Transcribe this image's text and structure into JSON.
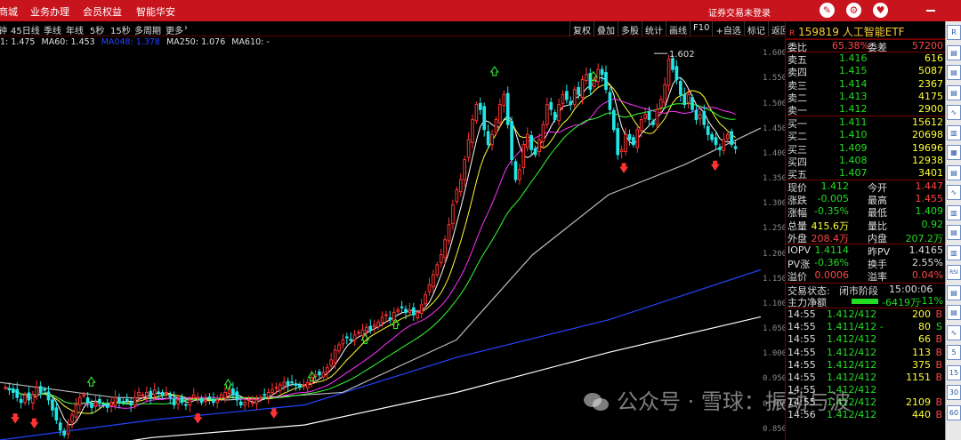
{
  "topbar": {
    "menu": [
      "商城",
      "业务办理",
      "会员权益",
      "智能华安"
    ],
    "login_text": "证券交易未登录",
    "icons": [
      "wrench-icon",
      "gear-icon",
      "shirt-icon",
      "minimize-icon"
    ]
  },
  "periodbar": {
    "items": [
      "钟",
      "45日线",
      "季线",
      "年线",
      "5秒",
      "15秒",
      "多周期",
      "更多",
      "›"
    ],
    "tools": [
      "复权",
      "叠加",
      "多股",
      "统计",
      "画线",
      "F10",
      "+自选",
      "标记",
      "返回"
    ]
  },
  "ma_legend": [
    {
      "text": "1: 1.475",
      "color": "#e0e0e0"
    },
    {
      "text": "MA60: 1.453",
      "color": "#e0e0e0"
    },
    {
      "text": "MA048: 1.378",
      "color": "#2244ff"
    },
    {
      "text": "MA250: 1.076",
      "color": "#e0e0e0"
    },
    {
      "text": "MA610: -",
      "color": "#e0e0e0"
    }
  ],
  "chart_data": {
    "type": "candlestick",
    "ylim": [
      0.83,
      1.62
    ],
    "yticks": [
      "1.600",
      "1.550",
      "1.500",
      "1.450",
      "1.400",
      "1.350",
      "1.300",
      "1.250",
      "1.200",
      "1.150",
      "1.100",
      "1.050",
      "1.000",
      "0.950",
      "0.900",
      "0.850"
    ],
    "high_label": "1.602",
    "closes": [
      0.935,
      0.93,
      0.925,
      0.915,
      0.905,
      0.92,
      0.91,
      0.92,
      0.935,
      0.925,
      0.93,
      0.91,
      0.89,
      0.87,
      0.85,
      0.84,
      0.86,
      0.88,
      0.9,
      0.915,
      0.92,
      0.905,
      0.895,
      0.905,
      0.905,
      0.9,
      0.895,
      0.905,
      0.915,
      0.905,
      0.905,
      0.91,
      0.9,
      0.915,
      0.925,
      0.92,
      0.925,
      0.915,
      0.93,
      0.925,
      0.92,
      0.925,
      0.915,
      0.9,
      0.91,
      0.905,
      0.9,
      0.91,
      0.92,
      0.915,
      0.905,
      0.91,
      0.915,
      0.905,
      0.91,
      0.92,
      0.925,
      0.93,
      0.92,
      0.91,
      0.9,
      0.905,
      0.91,
      0.905,
      0.91,
      0.915,
      0.92,
      0.925,
      0.93,
      0.935,
      0.94,
      0.945,
      0.94,
      0.945,
      0.94,
      0.935,
      0.94,
      0.945,
      0.955,
      0.96,
      0.96,
      0.965,
      0.975,
      0.99,
      1.01,
      1.02,
      1.03,
      1.035,
      1.03,
      1.04,
      1.045,
      1.05,
      1.055,
      1.05,
      1.06,
      1.065,
      1.075,
      1.08,
      1.07,
      1.085,
      1.09,
      1.095,
      1.085,
      1.09,
      1.08,
      1.085,
      1.1,
      1.12,
      1.14,
      1.16,
      1.18,
      1.2,
      1.23,
      1.26,
      1.3,
      1.33,
      1.35,
      1.39,
      1.43,
      1.47,
      1.5,
      1.49,
      1.45,
      1.42,
      1.44,
      1.47,
      1.5,
      1.52,
      1.46,
      1.39,
      1.35,
      1.37,
      1.42,
      1.44,
      1.41,
      1.4,
      1.43,
      1.46,
      1.5,
      1.49,
      1.47,
      1.5,
      1.52,
      1.51,
      1.5,
      1.53,
      1.52,
      1.55,
      1.56,
      1.53,
      1.55,
      1.57,
      1.56,
      1.53,
      1.49,
      1.45,
      1.4,
      1.41,
      1.44,
      1.43,
      1.42,
      1.45,
      1.47,
      1.48,
      1.47,
      1.46,
      1.49,
      1.51,
      1.54,
      1.59,
      1.57,
      1.55,
      1.52,
      1.5,
      1.52,
      1.49,
      1.47,
      1.48,
      1.46,
      1.44,
      1.43,
      1.42,
      1.41,
      1.43,
      1.44,
      1.42,
      1.412
    ],
    "ma_series": [
      {
        "name": "MA250",
        "color": "#ffffff",
        "points": [
          [
            0,
            0.79
          ],
          [
            0.2,
            0.835
          ],
          [
            0.4,
            0.86
          ],
          [
            0.6,
            0.925
          ],
          [
            0.8,
            1.005
          ],
          [
            1.0,
            1.076
          ]
        ]
      },
      {
        "name": "MA048",
        "color": "#2244ff",
        "points": [
          [
            0,
            0.83
          ],
          [
            0.2,
            0.87
          ],
          [
            0.4,
            0.9
          ],
          [
            0.6,
            0.995
          ],
          [
            0.8,
            1.07
          ],
          [
            1.0,
            1.17
          ]
        ]
      },
      {
        "name": "MA60",
        "color": "#bbbbbb",
        "points": [
          [
            0,
            0.945
          ],
          [
            0.15,
            0.915
          ],
          [
            0.3,
            0.91
          ],
          [
            0.45,
            0.925
          ],
          [
            0.6,
            1.03
          ],
          [
            0.7,
            1.2
          ],
          [
            0.8,
            1.32
          ],
          [
            0.9,
            1.38
          ],
          [
            1.0,
            1.453
          ]
        ]
      }
    ],
    "buy_markers": [
      [
        0.12,
        0.945
      ],
      [
        0.3,
        0.94
      ],
      [
        0.41,
        0.955
      ],
      [
        0.48,
        1.03
      ],
      [
        0.52,
        1.06
      ],
      [
        0.65,
        1.565
      ],
      [
        0.78,
        1.555
      ]
    ],
    "sell_markers": [
      [
        0.02,
        0.875
      ],
      [
        0.045,
        0.865
      ],
      [
        0.26,
        0.875
      ],
      [
        0.36,
        0.885
      ],
      [
        0.82,
        1.375
      ],
      [
        0.94,
        1.38
      ]
    ]
  },
  "panel": {
    "code": "159819",
    "name": "人工智能ETF",
    "weibi": {
      "label": "委比",
      "value": "65.38%",
      "label2": "委差",
      "value2": "57200"
    },
    "sells": [
      {
        "label": "卖五",
        "price": "1.416",
        "vol": "616"
      },
      {
        "label": "卖四",
        "price": "1.415",
        "vol": "5087"
      },
      {
        "label": "卖三",
        "price": "1.414",
        "vol": "2367"
      },
      {
        "label": "卖二",
        "price": "1.413",
        "vol": "4175"
      },
      {
        "label": "卖一",
        "price": "1.412",
        "vol": "2900"
      }
    ],
    "buys": [
      {
        "label": "买一",
        "price": "1.411",
        "vol": "15612"
      },
      {
        "label": "买二",
        "price": "1.410",
        "vol": "20698"
      },
      {
        "label": "买三",
        "price": "1.409",
        "vol": "19696"
      },
      {
        "label": "买四",
        "price": "1.408",
        "vol": "12938"
      },
      {
        "label": "买五",
        "price": "1.407",
        "vol": "3401"
      }
    ],
    "stats": [
      {
        "l1": "现价",
        "v1": "1.412",
        "c1": "green",
        "l2": "今开",
        "v2": "1.447",
        "c2": "red"
      },
      {
        "l1": "涨跌",
        "v1": "-0.005",
        "c1": "green",
        "l2": "最高",
        "v2": "1.455",
        "c2": "red"
      },
      {
        "l1": "涨幅",
        "v1": "-0.35%",
        "c1": "green",
        "l2": "最低",
        "v2": "1.409",
        "c2": "green"
      },
      {
        "l1": "总量",
        "v1": "415.6万",
        "c1": "yellow",
        "l2": "量比",
        "v2": "0.92",
        "c2": "green"
      },
      {
        "l1": "外盘",
        "v1": "208.4万",
        "c1": "red",
        "l2": "内盘",
        "v2": "207.2万",
        "c2": "green"
      }
    ],
    "iopv": [
      {
        "l1": "IOPV",
        "v1": "1.4114",
        "c1": "green",
        "l2": "昨PV",
        "v2": "1.4165",
        "c2": "white"
      },
      {
        "l1": "PV涨",
        "v1": "-0.36%",
        "c1": "green",
        "l2": "换手",
        "v2": "2.55%",
        "c2": "white"
      },
      {
        "l1": "溢价",
        "v1": "0.0006",
        "c1": "red",
        "l2": "溢率",
        "v2": "0.04%",
        "c2": "red"
      }
    ],
    "status": {
      "label": "交易状态:",
      "value": "闭市阶段",
      "time": "15:00:06"
    },
    "flow": {
      "label": "主力净额",
      "value": "-6419万",
      "pct": "-11%"
    },
    "ticks": [
      {
        "time": "14:55",
        "price": "1.412/412",
        "vol": "200",
        "flag": "B"
      },
      {
        "time": "14:55",
        "price": "1.411/412 -",
        "vol": "80",
        "flag": "S"
      },
      {
        "time": "14:55",
        "price": "1.412/412",
        "vol": "66",
        "flag": "B"
      },
      {
        "time": "14:55",
        "price": "1.412/412",
        "vol": "113",
        "flag": "B"
      },
      {
        "time": "14:55",
        "price": "1.412/412",
        "vol": "375",
        "flag": "B"
      },
      {
        "time": "14:55",
        "price": "1.412/412",
        "vol": "1151",
        "flag": "B"
      },
      {
        "time": "14:55",
        "price": "1.412/412",
        "vol": "",
        "flag": ""
      },
      {
        "time": "14:55",
        "price": "1.412/412",
        "vol": "2109",
        "flag": "B"
      },
      {
        "time": "14:56",
        "price": "1.412/412",
        "vol": "440",
        "flag": "B"
      }
    ]
  },
  "strip_icons": [
    "R",
    "▤",
    "▤",
    "▤",
    "∿",
    "▥",
    "▦",
    "▤",
    "∿",
    "▥",
    "▤",
    "▥",
    "RSI",
    "▤",
    "▤",
    "∿",
    "5",
    "15",
    "30",
    "60"
  ],
  "watermark": {
    "text": "公众号 · 雪球：振动与波"
  }
}
